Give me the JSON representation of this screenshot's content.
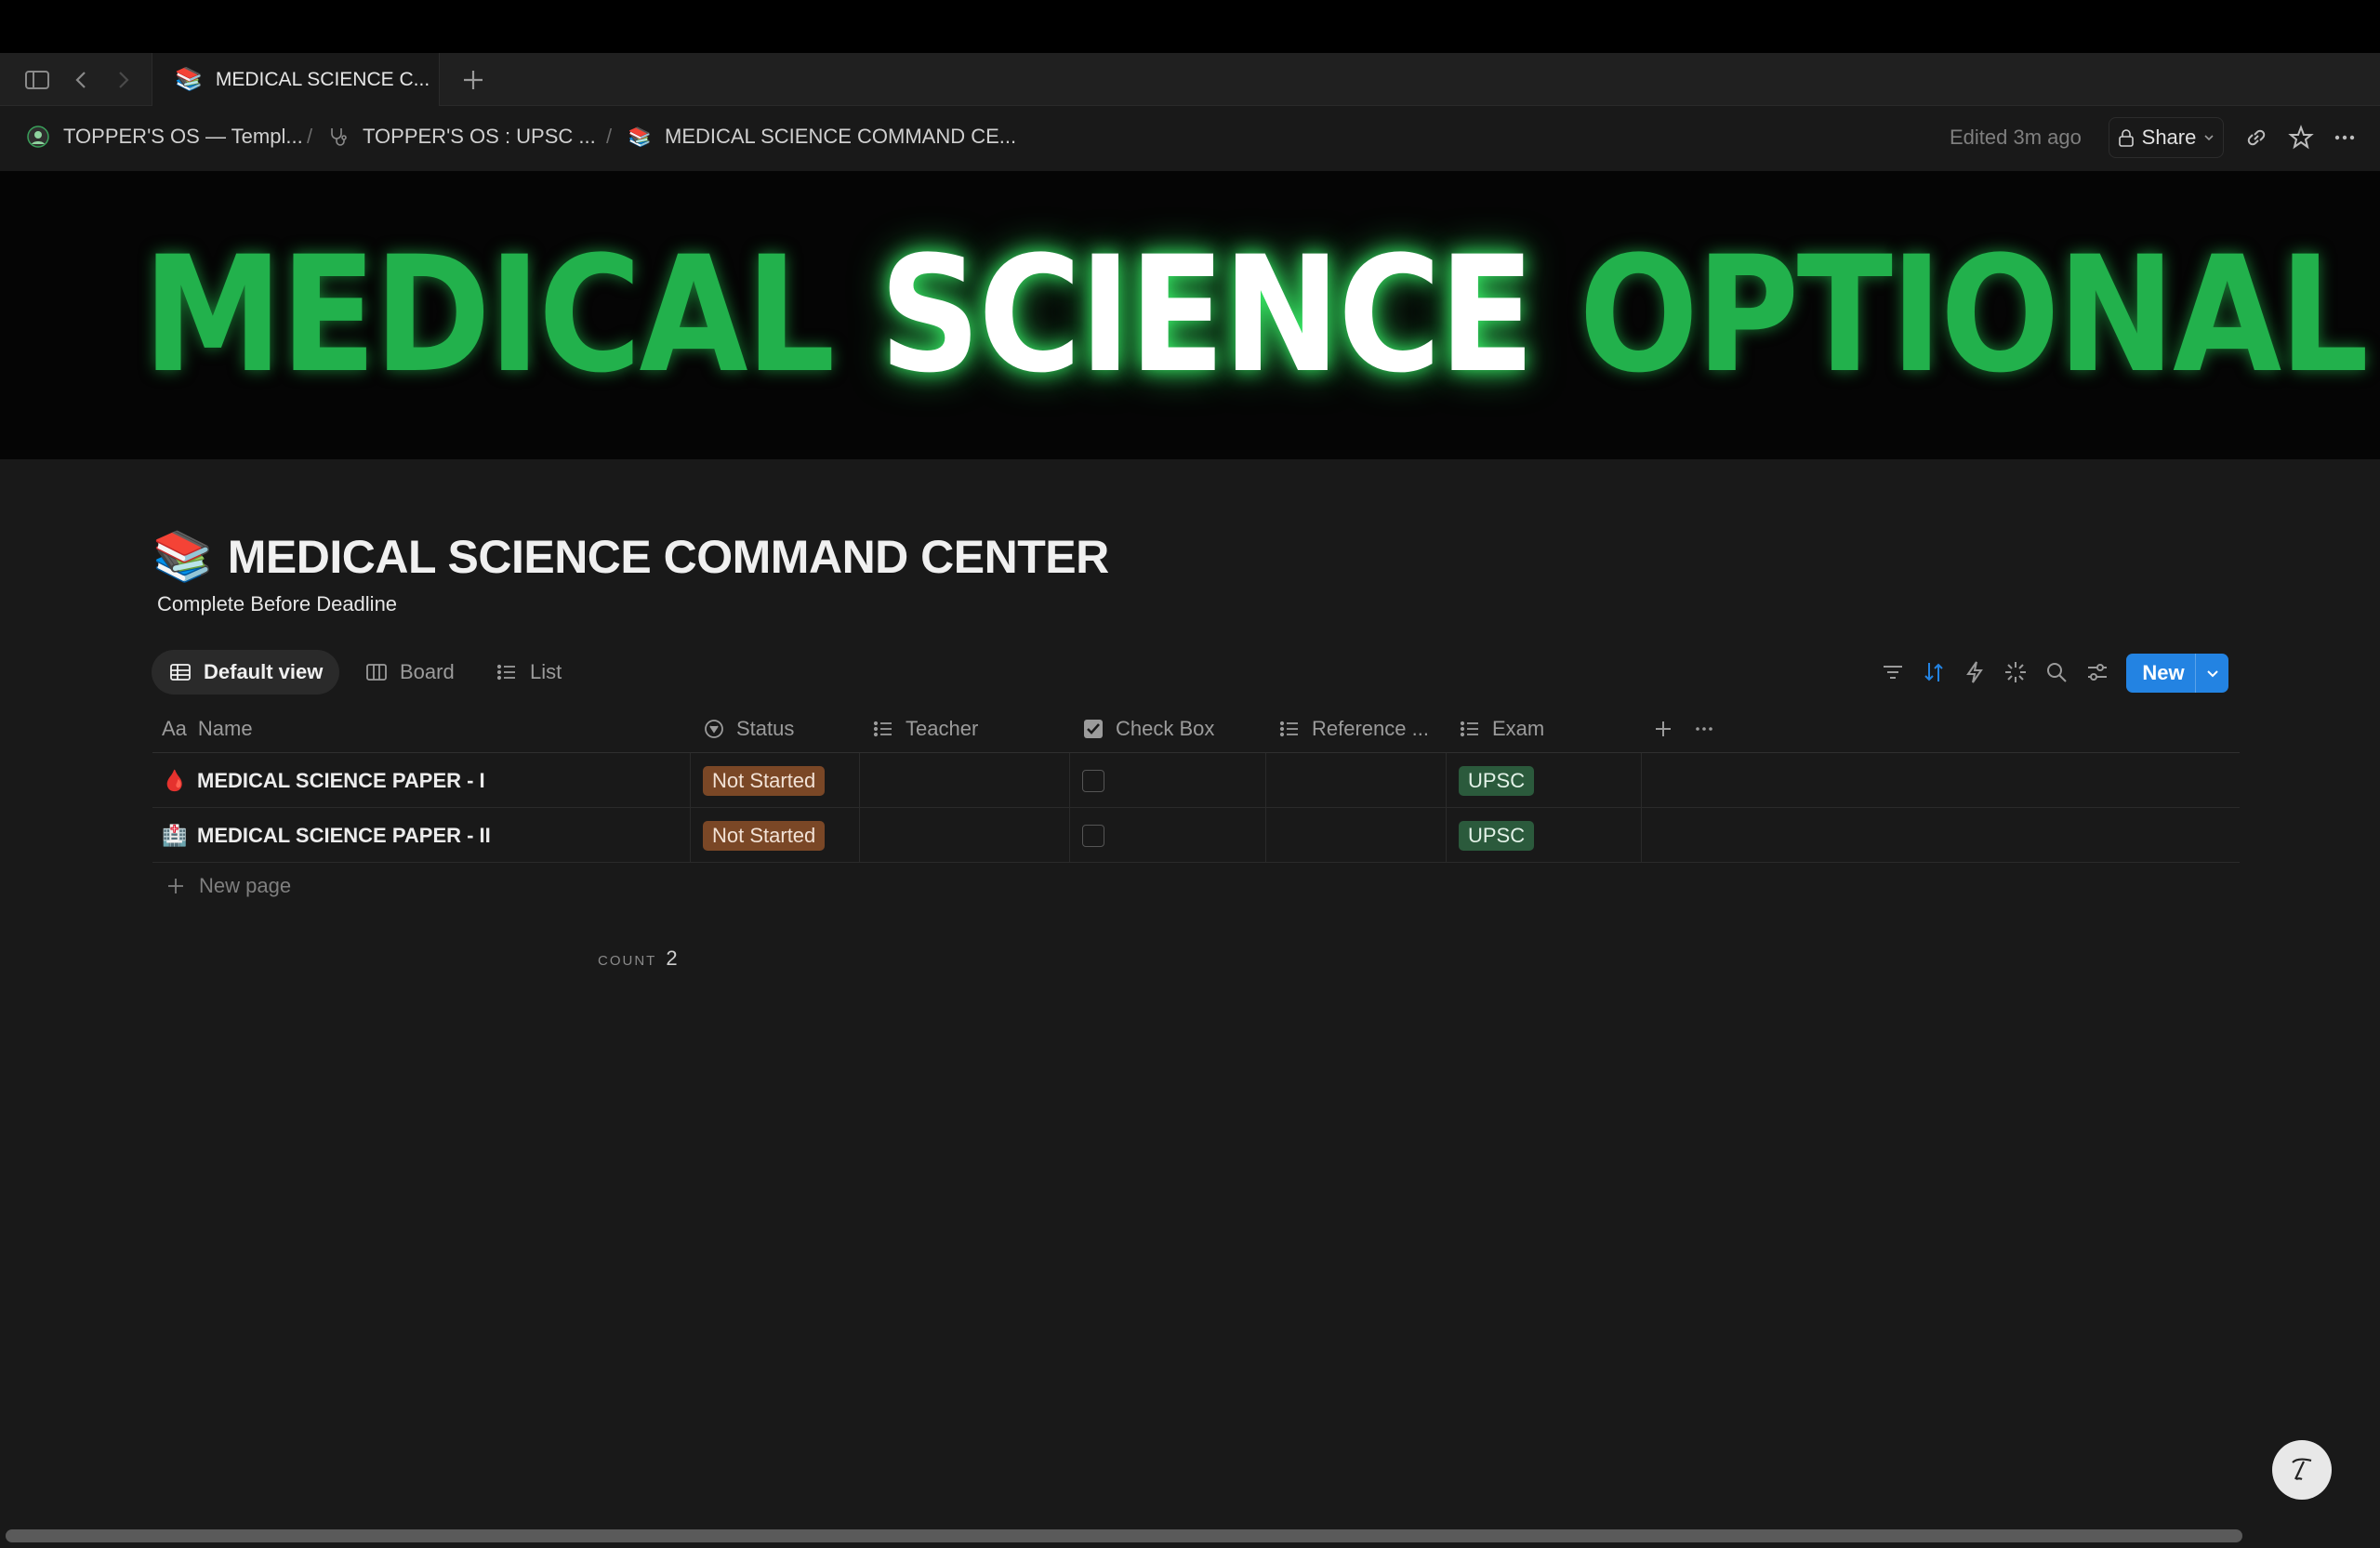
{
  "browser": {
    "tab_title": "MEDICAL SCIENCE C...",
    "tab_emoji": "📚"
  },
  "breadcrumbs": [
    {
      "label": "TOPPER'S OS — Templ..."
    },
    {
      "label": "TOPPER'S OS : UPSC ..."
    },
    {
      "label": "MEDICAL SCIENCE COMMAND CE..."
    }
  ],
  "breadcrumb_separator": "/",
  "header": {
    "edited": "Edited 3m ago",
    "share_label": "Share"
  },
  "banner": {
    "word1": "MEDICAL",
    "word2": "SCIENCE",
    "word3": "OPTIONAL",
    "colors": {
      "green": "#22b14c",
      "white": "#ffffff"
    }
  },
  "page": {
    "emoji": "📚",
    "title": "MEDICAL SCIENCE COMMAND CENTER",
    "subtitle": "Complete Before Deadline"
  },
  "views": [
    {
      "label": "Default view",
      "icon": "table-icon",
      "active": true
    },
    {
      "label": "Board",
      "icon": "board-icon",
      "active": false
    },
    {
      "label": "List",
      "icon": "list-icon",
      "active": false
    }
  ],
  "toolbar": {
    "new_label": "New",
    "accent": "#2383e2"
  },
  "table": {
    "columns": [
      {
        "label": "Name",
        "icon": "text-type-icon"
      },
      {
        "label": "Status",
        "icon": "status-icon"
      },
      {
        "label": "Teacher",
        "icon": "list-icon"
      },
      {
        "label": "Check Box",
        "icon": "checkbox-icon"
      },
      {
        "label": "Reference ...",
        "icon": "list-icon"
      },
      {
        "label": "Exam",
        "icon": "list-icon"
      }
    ],
    "rows": [
      {
        "emoji": "🩸",
        "name": "MEDICAL SCIENCE PAPER - I",
        "status": "Not Started",
        "teacher": "",
        "checked": false,
        "reference": "",
        "exam": "UPSC"
      },
      {
        "emoji": "🏥",
        "name": "MEDICAL SCIENCE PAPER - II",
        "status": "Not Started",
        "teacher": "",
        "checked": false,
        "reference": "",
        "exam": "UPSC"
      }
    ],
    "new_page_label": "New page",
    "count_label": "COUNT",
    "count_value": "2"
  },
  "status_colors": {
    "not_started_bg": "#7a4726",
    "upsc_bg": "#2b5a3c"
  }
}
